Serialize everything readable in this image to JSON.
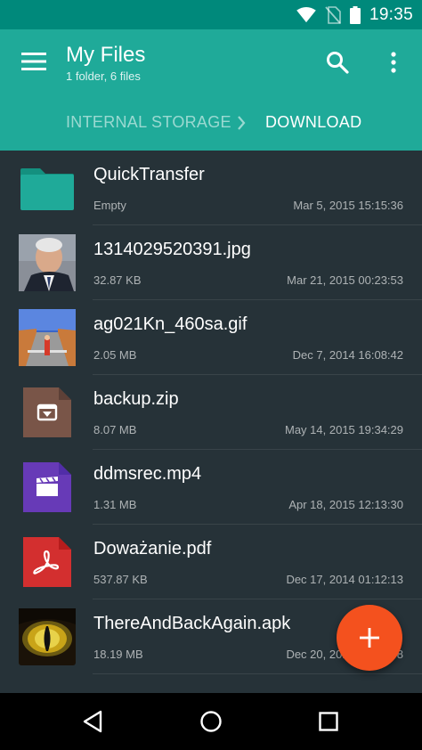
{
  "status_bar": {
    "time": "19:35",
    "icons": [
      "wifi-icon",
      "no-sim-icon",
      "battery-icon"
    ]
  },
  "app_bar": {
    "title": "My Files",
    "subtitle": "1 folder, 6 files",
    "menu_icon": "hamburger-menu-icon",
    "search_icon": "search-icon",
    "more_icon": "more-vert-icon"
  },
  "breadcrumb": {
    "items": [
      "INTERNAL STORAGE",
      "DOWNLOAD"
    ],
    "separator_icon": "chevron-right-icon"
  },
  "files": [
    {
      "name": "QuickTransfer",
      "meta": "Empty",
      "date": "Mar 5, 2015 15:15:36",
      "icon": "folder-icon",
      "color": "#1faa99"
    },
    {
      "name": "1314029520391.jpg",
      "meta": "32.87 KB",
      "date": "Mar 21, 2015 00:23:53",
      "icon": "image-thumbnail"
    },
    {
      "name": "ag021Kn_460sa.gif",
      "meta": "2.05 MB",
      "date": "Dec 7, 2014 16:08:42",
      "icon": "gif-thumbnail"
    },
    {
      "name": "backup.zip",
      "meta": "8.07 MB",
      "date": "May 14, 2015 19:34:29",
      "icon": "archive-file-icon",
      "color": "#795548"
    },
    {
      "name": "ddmsrec.mp4",
      "meta": "1.31 MB",
      "date": "Apr 18, 2015 12:13:30",
      "icon": "video-file-icon",
      "color": "#673ab7"
    },
    {
      "name": "Doważanie.pdf",
      "meta": "537.87 KB",
      "date": "Dec 17, 2014 01:12:13",
      "icon": "pdf-file-icon",
      "color": "#d32f2f"
    },
    {
      "name": "ThereAndBackAgain.apk",
      "meta": "18.19 MB",
      "date": "Dec 20, 2014 16:03:48",
      "icon": "apk-thumbnail"
    }
  ],
  "fab": {
    "icon": "add-icon",
    "color": "#f4511e"
  },
  "nav_bar": {
    "back_icon": "back-icon",
    "home_icon": "home-icon",
    "recents_icon": "recents-icon"
  }
}
